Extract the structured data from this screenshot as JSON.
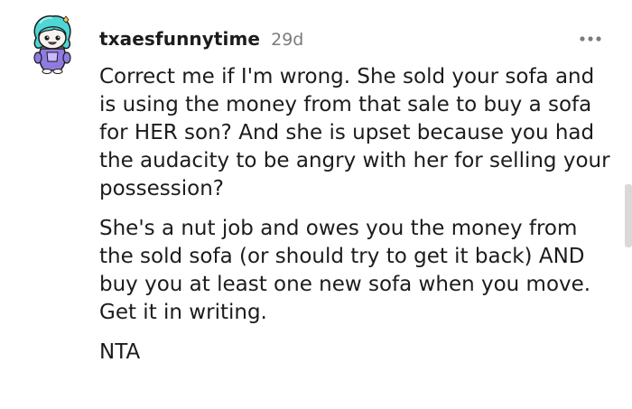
{
  "comment": {
    "username": "txaesfunnytime",
    "time_ago": "29d",
    "paragraphs": [
      "Correct me if I'm wrong. She sold your sofa and is using the money from that sale to buy a sofa for HER son? And she is upset because you had the audacity to be angry with her for selling your possession?",
      "She's a nut job and owes you the money from the sold sofa (or should try to get it back) AND buy you at least one new sofa when you move. Get it in writing.",
      "NTA"
    ],
    "avatar_icon": "snoo-avatar-icon",
    "more_icon": "more-options-icon"
  },
  "colors": {
    "text": "#1c1c1c",
    "meta": "#7c7c7c",
    "avatar_hair": "#4fd6d6",
    "avatar_outfit": "#8f7be0"
  }
}
